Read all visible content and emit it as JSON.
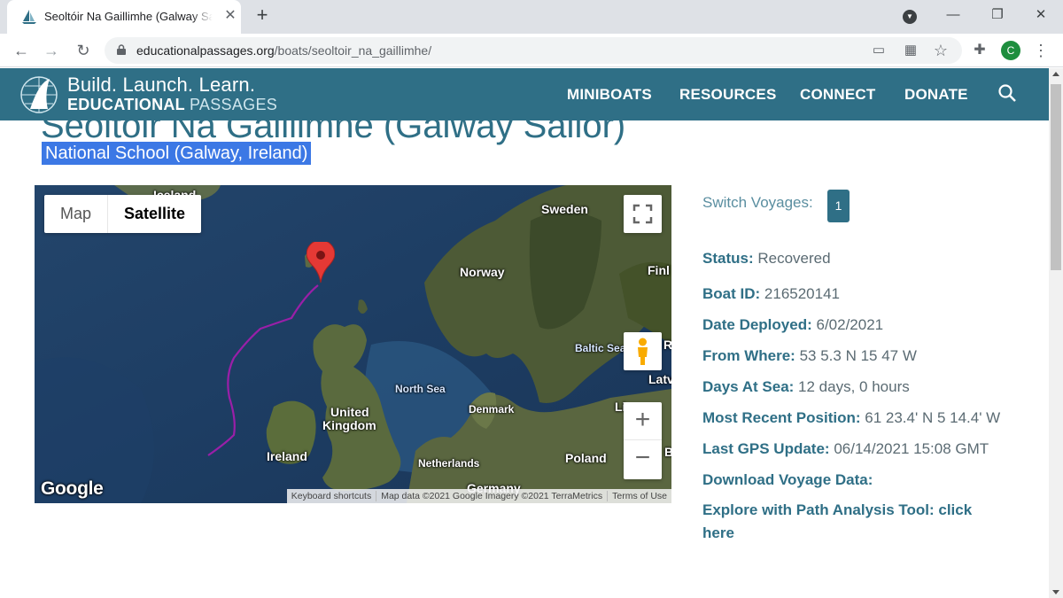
{
  "browser": {
    "tab_title": "Seoltóir Na Gaillimhe (Galway Sailor)",
    "tab_close": "✕",
    "new_tab": "+",
    "url_domain": "educationalpassages.org",
    "url_path": "/boats/seoltoir_na_gaillimhe/",
    "profile_initial": "C",
    "icons": [
      "back-icon",
      "forward-icon",
      "reload-icon",
      "lock-icon",
      "cast-icon",
      "apps-icon",
      "star-icon",
      "extensions-icon",
      "menu-icon",
      "minimize-icon",
      "maximize-icon",
      "close-icon"
    ]
  },
  "site": {
    "logo_tagline": "Build. Launch. Learn.",
    "logo_name_bold": "EDUCATIONAL",
    "logo_name_light": "PASSAGES",
    "nav": [
      "MINIBOATS",
      "RESOURCES",
      "CONNECT",
      "DONATE"
    ],
    "header_color": "#2f6f86"
  },
  "boat": {
    "title": "Seoltóir Na Gaillimhe (Galway Sailor)",
    "subtitle": "National School (Galway, Ireland)"
  },
  "map": {
    "type_map": "Map",
    "type_satellite": "Satellite",
    "selected_type": "Satellite",
    "zoom_in": "+",
    "zoom_out": "−",
    "labels": {
      "iceland": "Iceland",
      "sweden": "Sweden",
      "norway": "Norway",
      "finland": "Finl",
      "baltic": "Baltic Sea",
      "latvia": "Latv",
      "north_sea": "North Sea",
      "denmark": "Denmark",
      "lith": "Li",
      "uk_1": "United",
      "uk_2": "Kingdom",
      "ireland": "Ireland",
      "netherlands": "Netherlands",
      "poland": "Poland",
      "germany": "Germany",
      "belarus": "B",
      "russia": "Ro"
    },
    "google": "Google",
    "attribution": [
      "Keyboard shortcuts",
      "Map data ©2021 Google Imagery ©2021 TerraMetrics",
      "Terms of Use"
    ]
  },
  "details": {
    "switch_label": "Switch Voyages:",
    "voyage_number": "1",
    "status_key": "Status:",
    "status_val": "Recovered",
    "boat_id_key": "Boat ID:",
    "boat_id_val": "216520141",
    "deployed_key": "Date Deployed:",
    "deployed_val": "6/02/2021",
    "from_key": "From Where:",
    "from_val": "53 5.3 N 15 47 W",
    "days_key": "Days At Sea:",
    "days_val": "12 days, 0 hours",
    "recent_key": "Most Recent Position:",
    "recent_val": "61 23.4' N 5 14.4' W",
    "gps_key": "Last GPS Update:",
    "gps_val": "06/14/2021 15:08 GMT",
    "download": "Download Voyage Data:",
    "explore": "Explore with Path Analysis Tool: click here"
  }
}
